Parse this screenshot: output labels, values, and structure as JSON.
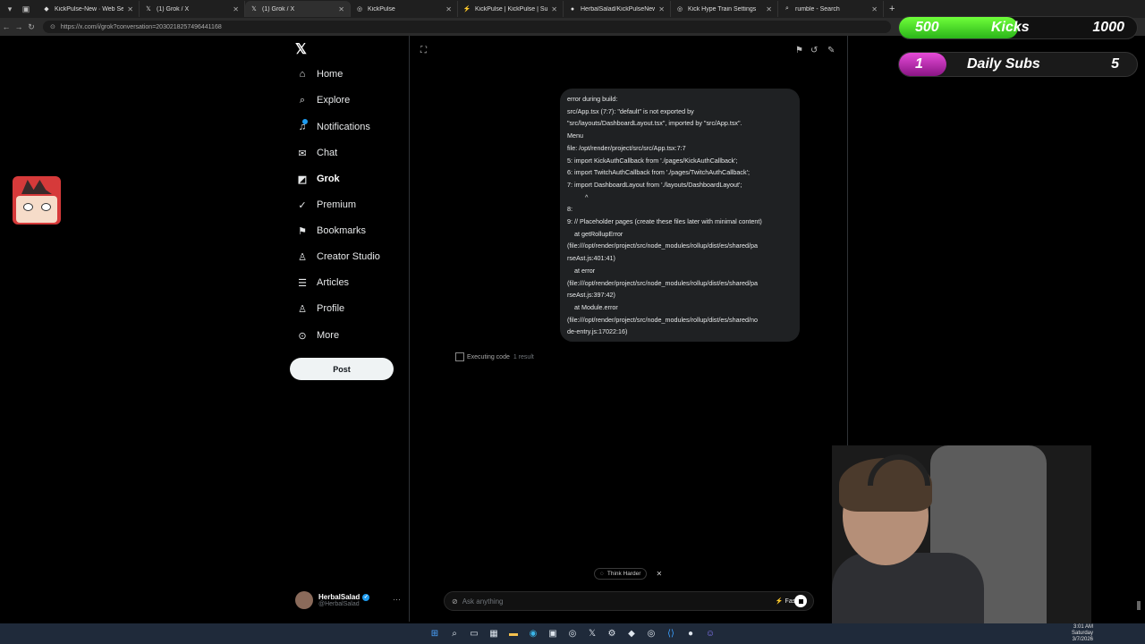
{
  "browser": {
    "tabs": [
      {
        "label": "KickPulse-New · Web Service · Re",
        "icon": "render-icon"
      },
      {
        "label": "(1) Grok / X",
        "icon": "x-icon"
      },
      {
        "label": "(1) Grok / X",
        "icon": "x-icon",
        "active": true
      },
      {
        "label": "KickPulse",
        "icon": "globe-icon"
      },
      {
        "label": "KickPulse | KickPulse | Supabase",
        "icon": "supabase-icon"
      },
      {
        "label": "HerbalSalad/KickPulseNew",
        "icon": "github-icon"
      },
      {
        "label": "Kick Hype Train Settings",
        "icon": "globe-icon"
      },
      {
        "label": "rumble - Search",
        "icon": "search-icon"
      }
    ],
    "url": "https://x.com/i/grok?conversation=2030218257496441168"
  },
  "sidebar": {
    "items": [
      {
        "label": "Home",
        "icon": "home-icon"
      },
      {
        "label": "Explore",
        "icon": "search-icon"
      },
      {
        "label": "Notifications",
        "icon": "bell-icon"
      },
      {
        "label": "Chat",
        "icon": "mail-icon"
      },
      {
        "label": "Grok",
        "icon": "grok-icon"
      },
      {
        "label": "Premium",
        "icon": "premium-icon"
      },
      {
        "label": "Bookmarks",
        "icon": "bookmark-icon"
      },
      {
        "label": "Creator Studio",
        "icon": "creator-icon"
      },
      {
        "label": "Articles",
        "icon": "articles-icon"
      },
      {
        "label": "Profile",
        "icon": "person-icon"
      },
      {
        "label": "More",
        "icon": "more-icon"
      }
    ],
    "post_label": "Post",
    "profile": {
      "name": "HerbalSalad",
      "handle": "@HerbalSalad"
    }
  },
  "chat": {
    "bubble_lines": [
      "error during build:",
      "src/App.tsx (7:7): \"default\" is not exported by",
      "\"src/layouts/DashboardLayout.tsx\", imported by \"src/App.tsx\".",
      "Menu",
      "file: /opt/render/project/src/src/App.tsx:7:7",
      "5: import KickAuthCallback from './pages/KickAuthCallback';",
      "6: import TwitchAuthCallback from './pages/TwitchAuthCallback';",
      "7: import DashboardLayout from './layouts/DashboardLayout';",
      "          ^",
      "8:",
      "9: // Placeholder pages (create these files later with minimal content)",
      "    at getRollupError",
      "(file:///opt/render/project/src/node_modules/rollup/dist/es/shared/pa",
      "rseAst.js:401:41)",
      "    at error",
      "(file:///opt/render/project/src/node_modules/rollup/dist/es/shared/pa",
      "rseAst.js:397:42)",
      "    at Module.error",
      "(file:///opt/render/project/src/node_modules/rollup/dist/es/shared/no",
      "de-entry.js:17022:16)"
    ],
    "executing_label": "Executing code",
    "result_count": "1 result",
    "think_harder": "Think Harder",
    "input_placeholder": "Ask anything",
    "mode": "Fast"
  },
  "overlay": {
    "kicks": {
      "current": "500",
      "label": "Kicks",
      "goal": "1000",
      "progress": 0.5,
      "color": "#3fd62a"
    },
    "subs": {
      "current": "1",
      "label": "Daily Subs",
      "goal": "5",
      "progress": 0.2,
      "color": "#c23bb8"
    }
  },
  "clock": {
    "time": "3:01 AM",
    "day": "Saturday",
    "date": "3/7/2026"
  }
}
